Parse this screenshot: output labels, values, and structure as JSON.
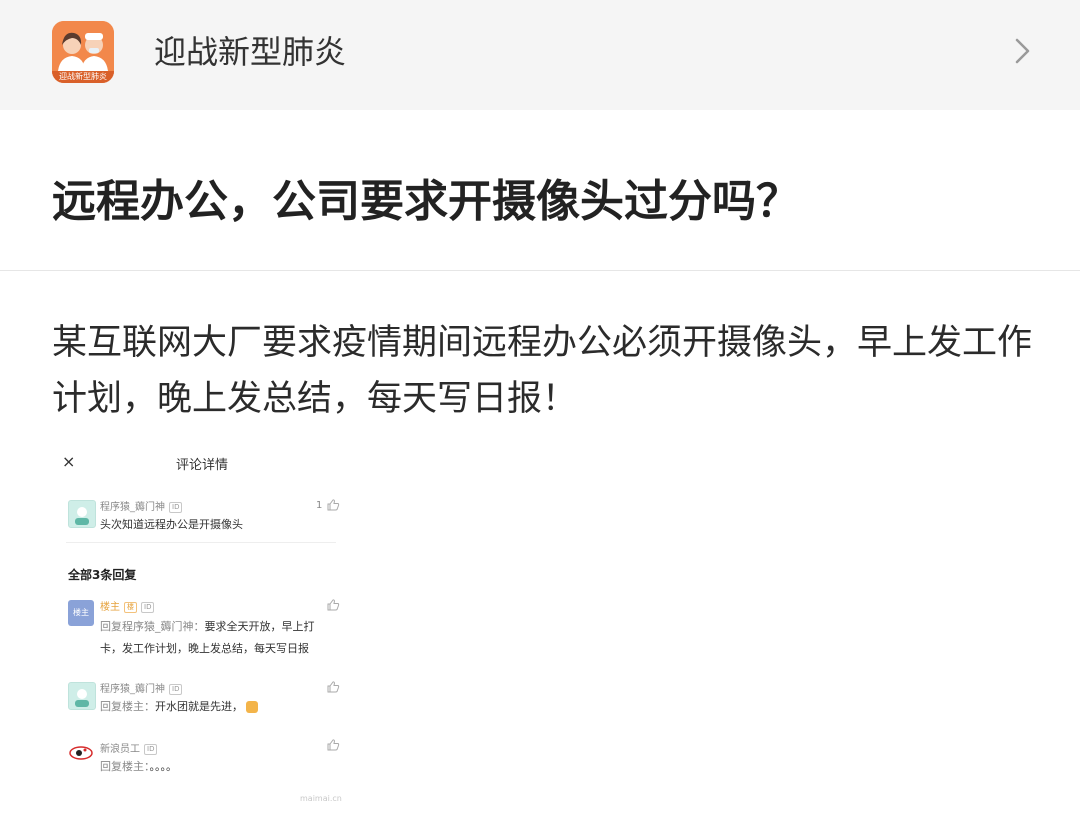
{
  "header": {
    "app_icon_caption": "迎战新型肺炎",
    "topic_name": "迎战新型肺炎"
  },
  "article": {
    "title": "远程办公，公司要求开摄像头过分吗？",
    "body": "某互联网大厂要求疫情期间远程办公必须开摄像头，早上发工作计划，晚上发总结，每天写日报！"
  },
  "embed": {
    "close_glyph": "×",
    "title": "评论详情",
    "main_comment": {
      "user": "程序猿_薅门神",
      "badge": "ID",
      "text": "头次知道远程办公是开摄像头",
      "likes": "1"
    },
    "section_label": "全部3条回复",
    "replies": [
      {
        "avatar_label": "楼主",
        "user": "楼主",
        "badge1": "楼",
        "badge2": "ID",
        "prefix": "回复程序猿_薅门神：",
        "text_line1": "要求全天开放，早上打",
        "text_line2": "卡，发工作计划，晚上发总结，每天写日报"
      },
      {
        "user": "程序猿_薅门神",
        "badge": "ID",
        "prefix": "回复楼主：",
        "text": "开水团就是先进，"
      },
      {
        "user": "新浪员工",
        "badge": "ID",
        "prefix": "回复楼主：",
        "text": "。。。。"
      }
    ],
    "watermark": "maimai.cn"
  },
  "colors": {
    "topbar_bg": "#f5f5f5",
    "host_name": "#e6a23c",
    "app_icon": "#f2884b"
  }
}
